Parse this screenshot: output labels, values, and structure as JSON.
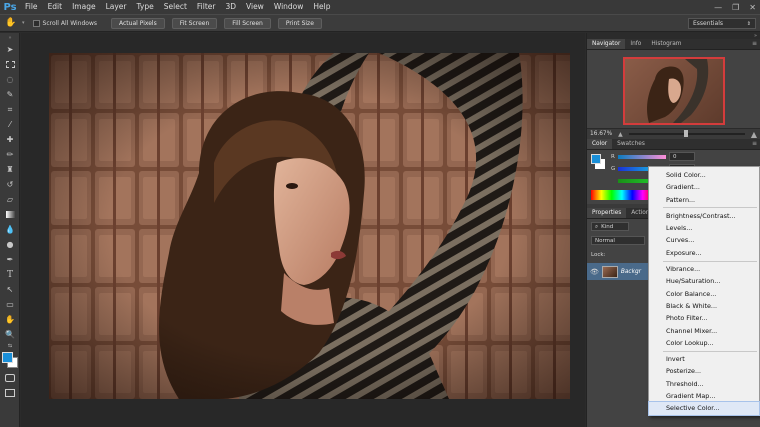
{
  "app": {
    "logo": "Ps"
  },
  "menu": [
    "File",
    "Edit",
    "Image",
    "Layer",
    "Type",
    "Select",
    "Filter",
    "3D",
    "View",
    "Window",
    "Help"
  ],
  "window_controls": {
    "minimize": "—",
    "restore": "❐",
    "close": "✕"
  },
  "options": {
    "scroll_all_windows": "Scroll All Windows",
    "buttons": [
      "Actual Pixels",
      "Fit Screen",
      "Fill Screen",
      "Print Size"
    ],
    "workspace": "Essentials"
  },
  "navigator": {
    "tabs": [
      "Navigator",
      "Info",
      "Histogram"
    ],
    "zoom": "16.67%"
  },
  "color_panel": {
    "tabs": [
      "Color",
      "Swatches"
    ],
    "r_label": "R",
    "g_label": "G",
    "r_value": "0",
    "g_value": "0"
  },
  "adjust_panel": {
    "tabs": [
      "Properties",
      "Actions"
    ],
    "kind": "Kind",
    "blend_mode": "Normal",
    "lock_label": "Lock:"
  },
  "layer": {
    "name": "Backgr"
  },
  "adjustments_menu": {
    "group1": [
      "Solid Color...",
      "Gradient...",
      "Pattern..."
    ],
    "group2": [
      "Brightness/Contrast...",
      "Levels...",
      "Curves...",
      "Exposure..."
    ],
    "group3": [
      "Vibrance...",
      "Hue/Saturation...",
      "Color Balance...",
      "Black & White...",
      "Photo Filter...",
      "Channel Mixer...",
      "Color Lookup..."
    ],
    "group4": [
      "Invert",
      "Posterize...",
      "Threshold...",
      "Gradient Map...",
      "Selective Color..."
    ]
  },
  "colors": {
    "foreground": "#1a8fd8",
    "background": "#ffffff",
    "navigator_frame": "#d43c3c"
  }
}
